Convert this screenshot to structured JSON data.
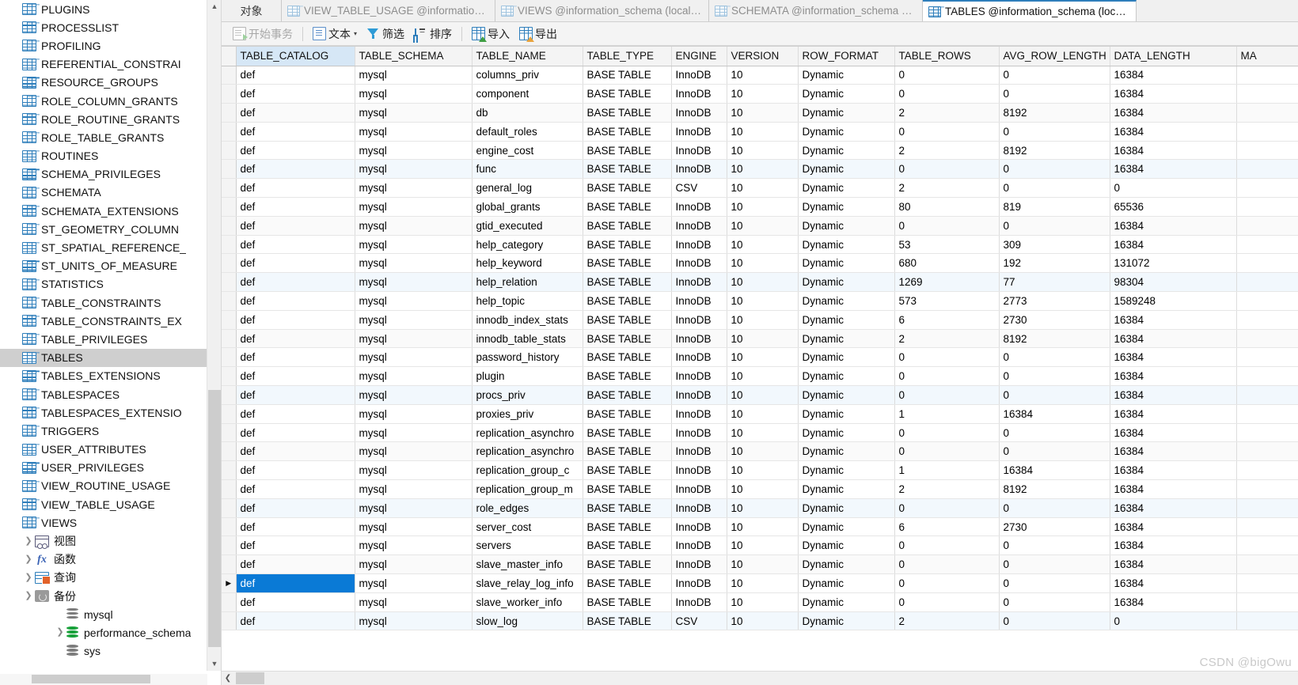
{
  "sidebar": {
    "items": [
      {
        "label": "PLUGINS",
        "icon": "table-icon",
        "depth": 3,
        "arrow": false
      },
      {
        "label": "PROCESSLIST",
        "icon": "table-icon",
        "depth": 3,
        "arrow": false
      },
      {
        "label": "PROFILING",
        "icon": "table-icon",
        "depth": 3,
        "arrow": false
      },
      {
        "label": "REFERENTIAL_CONSTRAI",
        "icon": "table-icon",
        "depth": 3,
        "arrow": false
      },
      {
        "label": "RESOURCE_GROUPS",
        "icon": "table-icon",
        "depth": 3,
        "arrow": false
      },
      {
        "label": "ROLE_COLUMN_GRANTS",
        "icon": "table-icon",
        "depth": 3,
        "arrow": false
      },
      {
        "label": "ROLE_ROUTINE_GRANTS",
        "icon": "table-icon",
        "depth": 3,
        "arrow": false
      },
      {
        "label": "ROLE_TABLE_GRANTS",
        "icon": "table-icon",
        "depth": 3,
        "arrow": false
      },
      {
        "label": "ROUTINES",
        "icon": "table-icon",
        "depth": 3,
        "arrow": false
      },
      {
        "label": "SCHEMA_PRIVILEGES",
        "icon": "table-icon",
        "depth": 3,
        "arrow": false
      },
      {
        "label": "SCHEMATA",
        "icon": "table-icon",
        "depth": 3,
        "arrow": false
      },
      {
        "label": "SCHEMATA_EXTENSIONS",
        "icon": "table-icon",
        "depth": 3,
        "arrow": false
      },
      {
        "label": "ST_GEOMETRY_COLUMN",
        "icon": "table-icon",
        "depth": 3,
        "arrow": false
      },
      {
        "label": "ST_SPATIAL_REFERENCE_",
        "icon": "table-icon",
        "depth": 3,
        "arrow": false
      },
      {
        "label": "ST_UNITS_OF_MEASURE",
        "icon": "table-icon",
        "depth": 3,
        "arrow": false
      },
      {
        "label": "STATISTICS",
        "icon": "table-icon",
        "depth": 3,
        "arrow": false
      },
      {
        "label": "TABLE_CONSTRAINTS",
        "icon": "table-icon",
        "depth": 3,
        "arrow": false
      },
      {
        "label": "TABLE_CONSTRAINTS_EX",
        "icon": "table-icon",
        "depth": 3,
        "arrow": false
      },
      {
        "label": "TABLE_PRIVILEGES",
        "icon": "table-icon",
        "depth": 3,
        "arrow": false
      },
      {
        "label": "TABLES",
        "icon": "table-icon",
        "depth": 3,
        "arrow": false,
        "selected": true
      },
      {
        "label": "TABLES_EXTENSIONS",
        "icon": "table-icon",
        "depth": 3,
        "arrow": false
      },
      {
        "label": "TABLESPACES",
        "icon": "table-icon",
        "depth": 3,
        "arrow": false
      },
      {
        "label": "TABLESPACES_EXTENSIO",
        "icon": "table-icon",
        "depth": 3,
        "arrow": false
      },
      {
        "label": "TRIGGERS",
        "icon": "table-icon",
        "depth": 3,
        "arrow": false
      },
      {
        "label": "USER_ATTRIBUTES",
        "icon": "table-icon",
        "depth": 3,
        "arrow": false
      },
      {
        "label": "USER_PRIVILEGES",
        "icon": "table-icon",
        "depth": 3,
        "arrow": false
      },
      {
        "label": "VIEW_ROUTINE_USAGE",
        "icon": "table-icon",
        "depth": 3,
        "arrow": false
      },
      {
        "label": "VIEW_TABLE_USAGE",
        "icon": "table-icon",
        "depth": 3,
        "arrow": false
      },
      {
        "label": "VIEWS",
        "icon": "table-icon",
        "depth": 3,
        "arrow": false
      },
      {
        "label": "视图",
        "icon": "view-icon",
        "depth": 2,
        "arrow": true
      },
      {
        "label": "函数",
        "icon": "function-icon",
        "depth": 2,
        "arrow": true
      },
      {
        "label": "查询",
        "icon": "query-icon",
        "depth": 2,
        "arrow": true
      },
      {
        "label": "备份",
        "icon": "backup-icon",
        "depth": 2,
        "arrow": true
      },
      {
        "label": "mysql",
        "icon": "database-icon",
        "depth": 1,
        "arrow": false
      },
      {
        "label": "performance_schema",
        "icon": "database-icon-green",
        "depth": 1,
        "arrow": true
      },
      {
        "label": "sys",
        "icon": "database-icon",
        "depth": 1,
        "arrow": false
      }
    ]
  },
  "tabs": {
    "object_tab_label": "对象",
    "documents": [
      {
        "label": "VIEW_TABLE_USAGE @information_s...",
        "icon": "table-icon",
        "active": false
      },
      {
        "label": "VIEWS @information_schema (localh...",
        "icon": "table-icon",
        "active": false
      },
      {
        "label": "SCHEMATA @information_schema (l...",
        "icon": "table-icon",
        "active": false
      },
      {
        "label": "TABLES @information_schema (local...",
        "icon": "table-icon",
        "active": true
      }
    ]
  },
  "toolbar": {
    "begin_transaction": "开始事务",
    "text": "文本",
    "filter": "筛选",
    "sort": "排序",
    "import": "导入",
    "export": "导出"
  },
  "grid": {
    "columns": [
      "TABLE_CATALOG",
      "TABLE_SCHEMA",
      "TABLE_NAME",
      "TABLE_TYPE",
      "ENGINE",
      "VERSION",
      "ROW_FORMAT",
      "TABLE_ROWS",
      "AVG_ROW_LENGTH",
      "DATA_LENGTH",
      "MA"
    ],
    "selected_cell": {
      "row": 27,
      "column": 0
    },
    "rows": [
      [
        "def",
        "mysql",
        "columns_priv",
        "BASE TABLE",
        "InnoDB",
        "10",
        "Dynamic",
        "0",
        "0",
        "16384",
        ""
      ],
      [
        "def",
        "mysql",
        "component",
        "BASE TABLE",
        "InnoDB",
        "10",
        "Dynamic",
        "0",
        "0",
        "16384",
        ""
      ],
      [
        "def",
        "mysql",
        "db",
        "BASE TABLE",
        "InnoDB",
        "10",
        "Dynamic",
        "2",
        "8192",
        "16384",
        ""
      ],
      [
        "def",
        "mysql",
        "default_roles",
        "BASE TABLE",
        "InnoDB",
        "10",
        "Dynamic",
        "0",
        "0",
        "16384",
        ""
      ],
      [
        "def",
        "mysql",
        "engine_cost",
        "BASE TABLE",
        "InnoDB",
        "10",
        "Dynamic",
        "2",
        "8192",
        "16384",
        ""
      ],
      [
        "def",
        "mysql",
        "func",
        "BASE TABLE",
        "InnoDB",
        "10",
        "Dynamic",
        "0",
        "0",
        "16384",
        ""
      ],
      [
        "def",
        "mysql",
        "general_log",
        "BASE TABLE",
        "CSV",
        "10",
        "Dynamic",
        "2",
        "0",
        "0",
        ""
      ],
      [
        "def",
        "mysql",
        "global_grants",
        "BASE TABLE",
        "InnoDB",
        "10",
        "Dynamic",
        "80",
        "819",
        "65536",
        ""
      ],
      [
        "def",
        "mysql",
        "gtid_executed",
        "BASE TABLE",
        "InnoDB",
        "10",
        "Dynamic",
        "0",
        "0",
        "16384",
        ""
      ],
      [
        "def",
        "mysql",
        "help_category",
        "BASE TABLE",
        "InnoDB",
        "10",
        "Dynamic",
        "53",
        "309",
        "16384",
        ""
      ],
      [
        "def",
        "mysql",
        "help_keyword",
        "BASE TABLE",
        "InnoDB",
        "10",
        "Dynamic",
        "680",
        "192",
        "131072",
        ""
      ],
      [
        "def",
        "mysql",
        "help_relation",
        "BASE TABLE",
        "InnoDB",
        "10",
        "Dynamic",
        "1269",
        "77",
        "98304",
        ""
      ],
      [
        "def",
        "mysql",
        "help_topic",
        "BASE TABLE",
        "InnoDB",
        "10",
        "Dynamic",
        "573",
        "2773",
        "1589248",
        ""
      ],
      [
        "def",
        "mysql",
        "innodb_index_stats",
        "BASE TABLE",
        "InnoDB",
        "10",
        "Dynamic",
        "6",
        "2730",
        "16384",
        ""
      ],
      [
        "def",
        "mysql",
        "innodb_table_stats",
        "BASE TABLE",
        "InnoDB",
        "10",
        "Dynamic",
        "2",
        "8192",
        "16384",
        ""
      ],
      [
        "def",
        "mysql",
        "password_history",
        "BASE TABLE",
        "InnoDB",
        "10",
        "Dynamic",
        "0",
        "0",
        "16384",
        ""
      ],
      [
        "def",
        "mysql",
        "plugin",
        "BASE TABLE",
        "InnoDB",
        "10",
        "Dynamic",
        "0",
        "0",
        "16384",
        ""
      ],
      [
        "def",
        "mysql",
        "procs_priv",
        "BASE TABLE",
        "InnoDB",
        "10",
        "Dynamic",
        "0",
        "0",
        "16384",
        ""
      ],
      [
        "def",
        "mysql",
        "proxies_priv",
        "BASE TABLE",
        "InnoDB",
        "10",
        "Dynamic",
        "1",
        "16384",
        "16384",
        ""
      ],
      [
        "def",
        "mysql",
        "replication_asynchro",
        "BASE TABLE",
        "InnoDB",
        "10",
        "Dynamic",
        "0",
        "0",
        "16384",
        ""
      ],
      [
        "def",
        "mysql",
        "replication_asynchro",
        "BASE TABLE",
        "InnoDB",
        "10",
        "Dynamic",
        "0",
        "0",
        "16384",
        ""
      ],
      [
        "def",
        "mysql",
        "replication_group_c",
        "BASE TABLE",
        "InnoDB",
        "10",
        "Dynamic",
        "1",
        "16384",
        "16384",
        ""
      ],
      [
        "def",
        "mysql",
        "replication_group_m",
        "BASE TABLE",
        "InnoDB",
        "10",
        "Dynamic",
        "2",
        "8192",
        "16384",
        ""
      ],
      [
        "def",
        "mysql",
        "role_edges",
        "BASE TABLE",
        "InnoDB",
        "10",
        "Dynamic",
        "0",
        "0",
        "16384",
        ""
      ],
      [
        "def",
        "mysql",
        "server_cost",
        "BASE TABLE",
        "InnoDB",
        "10",
        "Dynamic",
        "6",
        "2730",
        "16384",
        ""
      ],
      [
        "def",
        "mysql",
        "servers",
        "BASE TABLE",
        "InnoDB",
        "10",
        "Dynamic",
        "0",
        "0",
        "16384",
        ""
      ],
      [
        "def",
        "mysql",
        "slave_master_info",
        "BASE TABLE",
        "InnoDB",
        "10",
        "Dynamic",
        "0",
        "0",
        "16384",
        ""
      ],
      [
        "def",
        "mysql",
        "slave_relay_log_info",
        "BASE TABLE",
        "InnoDB",
        "10",
        "Dynamic",
        "0",
        "0",
        "16384",
        ""
      ],
      [
        "def",
        "mysql",
        "slave_worker_info",
        "BASE TABLE",
        "InnoDB",
        "10",
        "Dynamic",
        "0",
        "0",
        "16384",
        ""
      ],
      [
        "def",
        "mysql",
        "slow_log",
        "BASE TABLE",
        "CSV",
        "10",
        "Dynamic",
        "2",
        "0",
        "0",
        ""
      ]
    ]
  },
  "watermark": "CSDN @bigOwu",
  "colors": {
    "selection_blue": "#0a7ad6",
    "header_highlight": "#d6e7f6",
    "tree_selected": "#cfcfcf",
    "icon_blue": "#2e7ebb"
  }
}
